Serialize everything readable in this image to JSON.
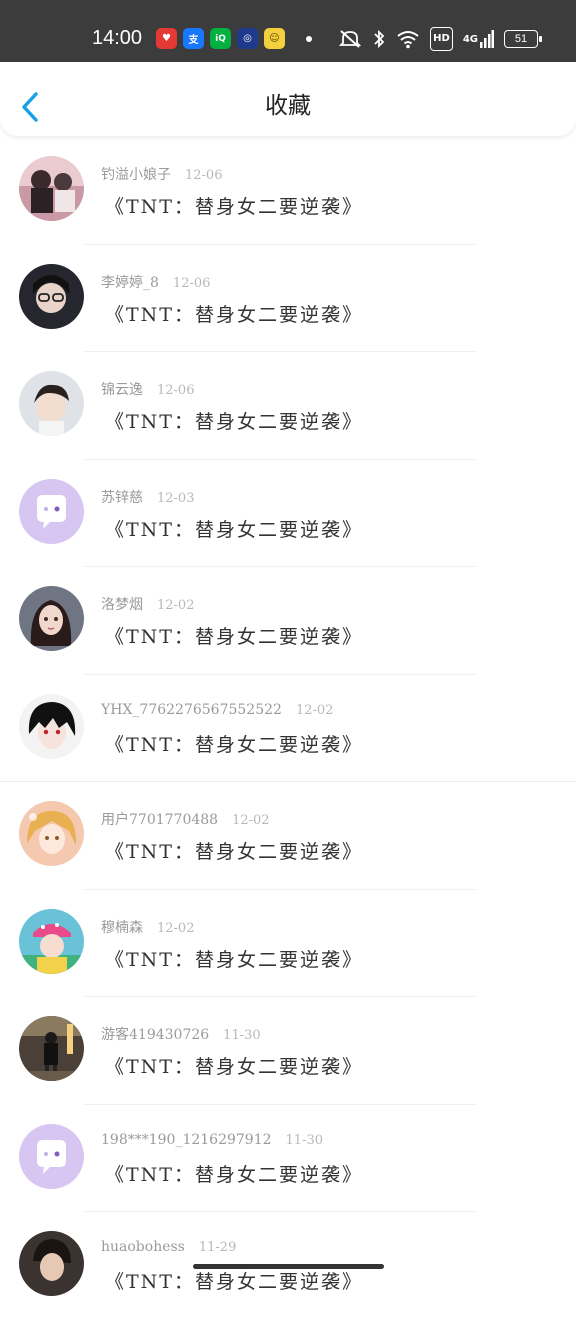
{
  "status_bar": {
    "time": "14:00",
    "apps": [
      {
        "icon": "heart-app-icon",
        "color": "#e53935",
        "glyph": "♥"
      },
      {
        "icon": "alipay-app-icon",
        "color": "#1677ff",
        "glyph": "支"
      },
      {
        "icon": "iqiyi-app-icon",
        "color": "#00b140",
        "glyph": "iQ"
      },
      {
        "icon": "circle-app-icon",
        "color": "#1e3a8a",
        "glyph": "◎"
      },
      {
        "icon": "yellow-app-icon",
        "color": "#f4d03f",
        "glyph": "☺"
      }
    ],
    "hd": "HD",
    "network": "4G",
    "battery": "51"
  },
  "header": {
    "title": "收藏",
    "back_icon": "chevron-left-icon",
    "accent": "#1aa0e8"
  },
  "list": {
    "items": [
      {
        "name": "钓溢小娘子",
        "time": "12-06",
        "content": "《TNT：替身女二要逆袭》",
        "avatar": "photo-couple"
      },
      {
        "name": "李婷婷_8",
        "time": "12-06",
        "content": "《TNT：替身女二要逆袭》",
        "avatar": "photo-glasses-girl"
      },
      {
        "name": "锦云逸",
        "time": "12-06",
        "content": "《TNT：替身女二要逆袭》",
        "avatar": "photo-boy"
      },
      {
        "name": "苏锌慈",
        "time": "12-03",
        "content": "《TNT：替身女二要逆袭》",
        "avatar": "default-chat"
      },
      {
        "name": "洛梦烟",
        "time": "12-02",
        "content": "《TNT：替身女二要逆袭》",
        "avatar": "photo-anime-girl"
      },
      {
        "name": "YHX_7762276567552522",
        "time": "12-02",
        "content": "《TNT：替身女二要逆袭》",
        "avatar": "photo-anime-boy"
      },
      {
        "name": "用户7701770488",
        "time": "12-02",
        "content": "《TNT：替身女二要逆袭》",
        "avatar": "photo-blonde-anime"
      },
      {
        "name": "穆楠森",
        "time": "12-02",
        "content": "《TNT：替身女二要逆袭》",
        "avatar": "photo-hat-girl"
      },
      {
        "name": "游客419430726",
        "time": "11-30",
        "content": "《TNT：替身女二要逆袭》",
        "avatar": "photo-street"
      },
      {
        "name": "198***190_1216297912",
        "time": "11-30",
        "content": "《TNT：替身女二要逆袭》",
        "avatar": "default-chat"
      },
      {
        "name": "huaobohess",
        "time": "11-29",
        "content": "《TNT：替身女二要逆袭》",
        "avatar": "photo-dark"
      }
    ]
  }
}
